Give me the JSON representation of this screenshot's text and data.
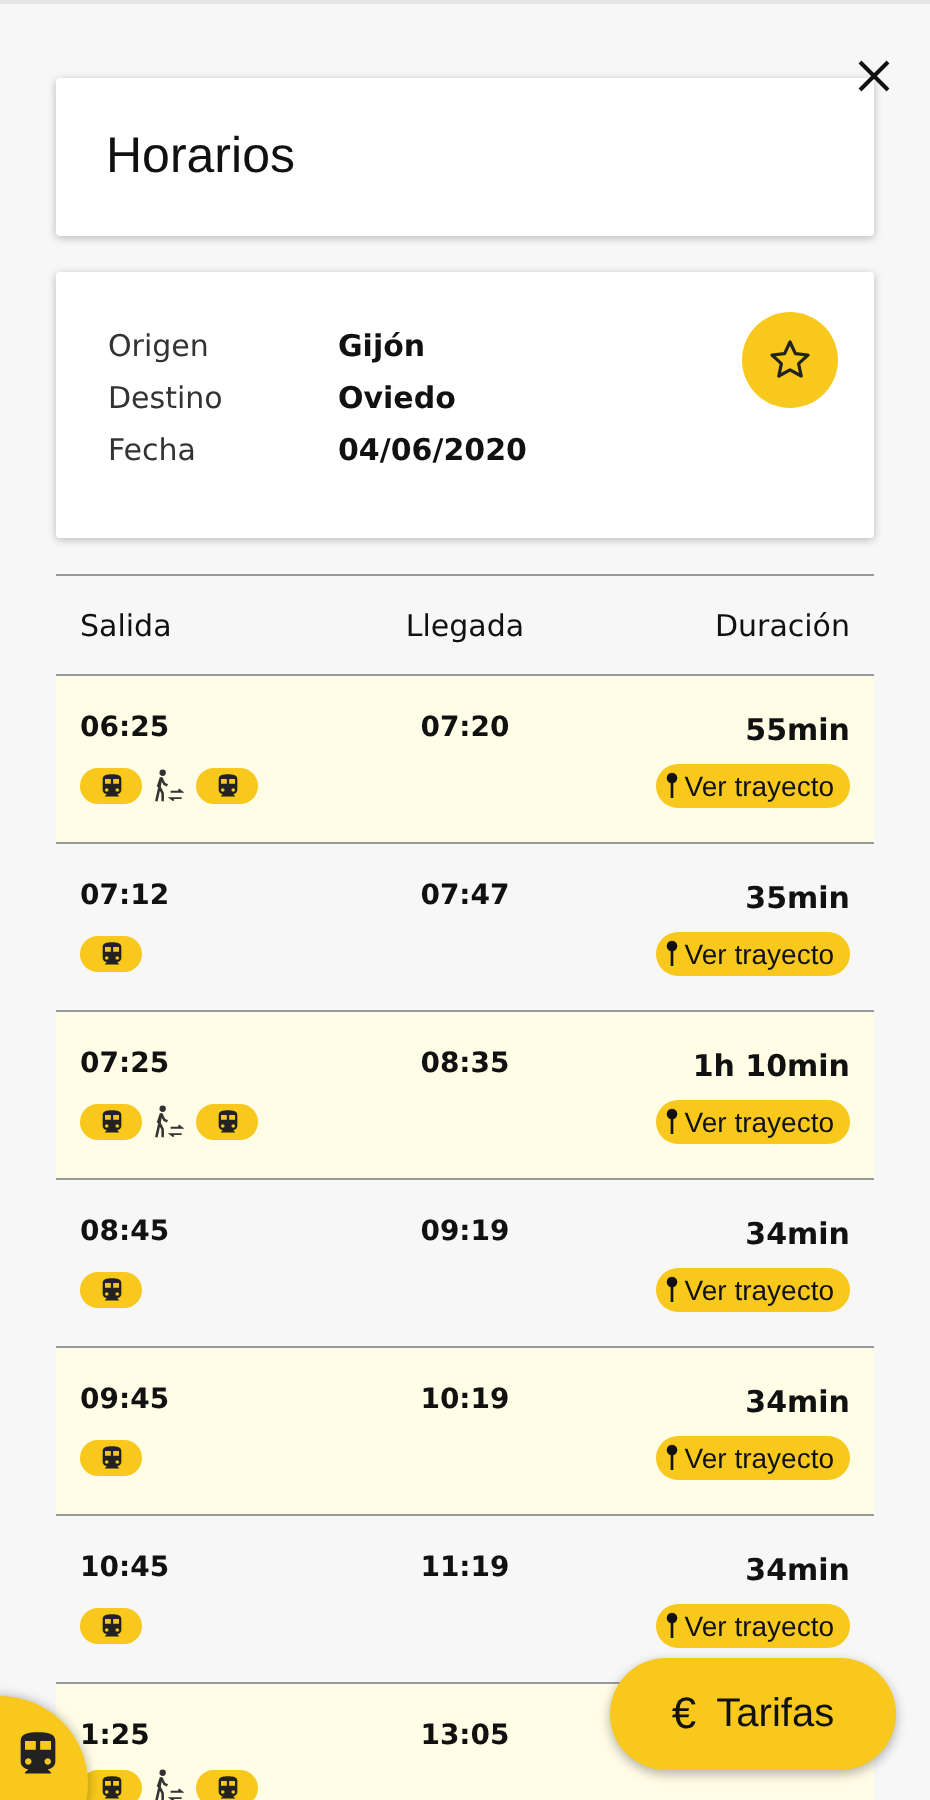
{
  "header": {
    "title": "Horarios"
  },
  "trip": {
    "fields": [
      {
        "label": "Origen",
        "value": "Gijón"
      },
      {
        "label": "Destino",
        "value": "Oviedo"
      },
      {
        "label": "Fecha",
        "value": "04/06/2020"
      }
    ],
    "favorite": false
  },
  "table": {
    "columns": [
      "Salida",
      "Llegada",
      "Duración"
    ],
    "rows": [
      {
        "departure": "06:25",
        "arrival": "07:20",
        "duration": "55min",
        "legs": [
          {
            "kind": "train"
          },
          {
            "kind": "transfer"
          },
          {
            "kind": "train"
          }
        ],
        "route_button": "Ver trayecto"
      },
      {
        "departure": "07:12",
        "arrival": "07:47",
        "duration": "35min",
        "legs": [
          {
            "kind": "train"
          }
        ],
        "route_button": "Ver trayecto"
      },
      {
        "departure": "07:25",
        "arrival": "08:35",
        "duration": "1h 10min",
        "legs": [
          {
            "kind": "train"
          },
          {
            "kind": "transfer"
          },
          {
            "kind": "train"
          }
        ],
        "route_button": "Ver trayecto"
      },
      {
        "departure": "08:45",
        "arrival": "09:19",
        "duration": "34min",
        "legs": [
          {
            "kind": "train"
          }
        ],
        "route_button": "Ver trayecto"
      },
      {
        "departure": "09:45",
        "arrival": "10:19",
        "duration": "34min",
        "legs": [
          {
            "kind": "train"
          }
        ],
        "route_button": "Ver trayecto"
      },
      {
        "departure": "10:45",
        "arrival": "11:19",
        "duration": "34min",
        "legs": [
          {
            "kind": "train"
          }
        ],
        "route_button": "Ver trayecto"
      },
      {
        "departure": "1:25",
        "arrival": "13:05",
        "legs": [
          {
            "kind": "train"
          },
          {
            "kind": "transfer"
          },
          {
            "kind": "train"
          }
        ]
      }
    ]
  },
  "fare_button": {
    "icon": "€",
    "label": "Tarifas"
  }
}
